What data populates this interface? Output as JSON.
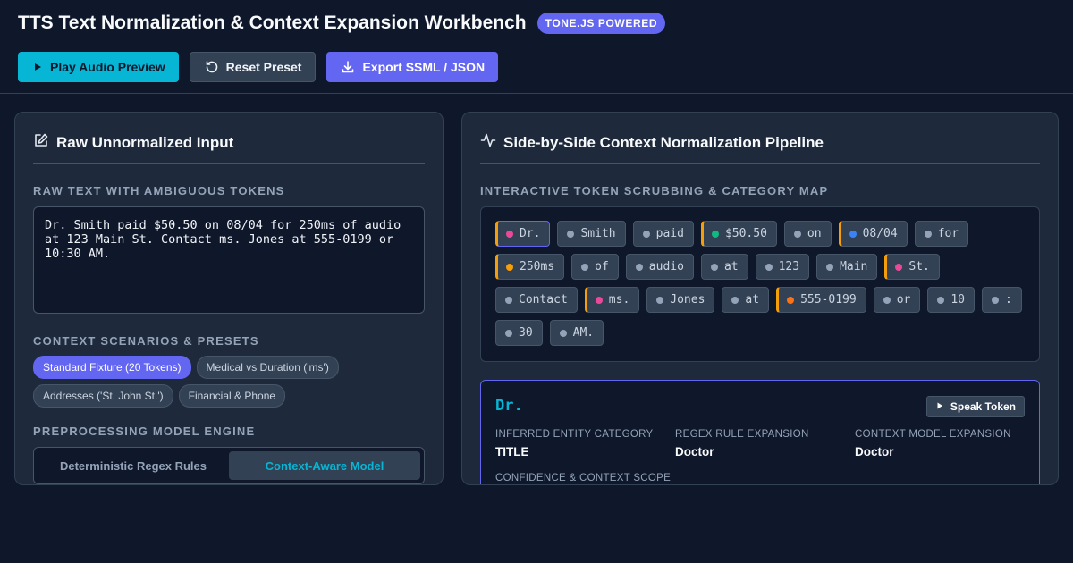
{
  "header": {
    "title": "TTS Text Normalization & Context Expansion Workbench",
    "badge": "TONE.JS POWERED",
    "buttons": {
      "play": "Play Audio Preview",
      "reset": "Reset Preset",
      "export": "Export SSML / JSON"
    }
  },
  "left_panel": {
    "title": "Raw Unnormalized Input",
    "raw_label": "RAW TEXT WITH AMBIGUOUS TOKENS",
    "raw_text": "Dr. Smith paid $50.50 on 08/04 for 250ms of audio at 123 Main St. Contact ms. Jones at 555-0199 or 10:30 AM.",
    "presets_label": "CONTEXT SCENARIOS & PRESETS",
    "presets": [
      {
        "label": "Standard Fixture (20 Tokens)",
        "active": true
      },
      {
        "label": "Medical vs Duration ('ms')",
        "active": false
      },
      {
        "label": "Addresses ('St. John St.')",
        "active": false
      },
      {
        "label": "Financial & Phone",
        "active": false
      }
    ],
    "engine_label": "PREPROCESSING MODEL ENGINE",
    "engine_options": [
      {
        "label": "Deterministic Regex Rules",
        "active": false
      },
      {
        "label": "Context-Aware Model",
        "active": true
      }
    ]
  },
  "right_panel": {
    "title": "Side-by-Side Context Normalization Pipeline",
    "map_label": "INTERACTIVE TOKEN SCRUBBING & CATEGORY MAP",
    "category_colors": {
      "title": "#ec4899",
      "plain": "#94a3b8",
      "currency": "#10b981",
      "date": "#3b82f6",
      "duration": "#f59e0b",
      "phone": "#f97316"
    },
    "tokens": [
      {
        "text": "Dr.",
        "category": "title",
        "ambiguous": true,
        "selected": true
      },
      {
        "text": "Smith",
        "category": "plain",
        "ambiguous": false
      },
      {
        "text": "paid",
        "category": "plain",
        "ambiguous": false
      },
      {
        "text": "$50.50",
        "category": "currency",
        "ambiguous": true
      },
      {
        "text": "on",
        "category": "plain",
        "ambiguous": false
      },
      {
        "text": "08/04",
        "category": "date",
        "ambiguous": true
      },
      {
        "text": "for",
        "category": "plain",
        "ambiguous": false
      },
      {
        "text": "250ms",
        "category": "duration",
        "ambiguous": true
      },
      {
        "text": "of",
        "category": "plain",
        "ambiguous": false
      },
      {
        "text": "audio",
        "category": "plain",
        "ambiguous": false
      },
      {
        "text": "at",
        "category": "plain",
        "ambiguous": false
      },
      {
        "text": "123",
        "category": "plain",
        "ambiguous": false
      },
      {
        "text": "Main",
        "category": "plain",
        "ambiguous": false
      },
      {
        "text": "St.",
        "category": "title",
        "ambiguous": true
      },
      {
        "text": "Contact",
        "category": "plain",
        "ambiguous": false
      },
      {
        "text": "ms.",
        "category": "title",
        "ambiguous": true
      },
      {
        "text": "Jones",
        "category": "plain",
        "ambiguous": false
      },
      {
        "text": "at",
        "category": "plain",
        "ambiguous": false
      },
      {
        "text": "555-0199",
        "category": "phone",
        "ambiguous": true
      },
      {
        "text": "or",
        "category": "plain",
        "ambiguous": false
      },
      {
        "text": "10",
        "category": "plain",
        "ambiguous": false
      },
      {
        "text": ":",
        "category": "plain",
        "ambiguous": false
      },
      {
        "text": "30",
        "category": "plain",
        "ambiguous": false
      },
      {
        "text": "AM.",
        "category": "plain",
        "ambiguous": false
      }
    ],
    "detail": {
      "token": "Dr.",
      "speak_label": "Speak Token",
      "category_label": "INFERRED ENTITY CATEGORY",
      "category_value": "TITLE",
      "regex_label": "REGEX RULE EXPANSION",
      "regex_value": "Doctor",
      "context_label": "CONTEXT MODEL EXPANSION",
      "context_value": "Doctor",
      "confidence_label": "CONFIDENCE & CONTEXT SCOPE"
    }
  }
}
